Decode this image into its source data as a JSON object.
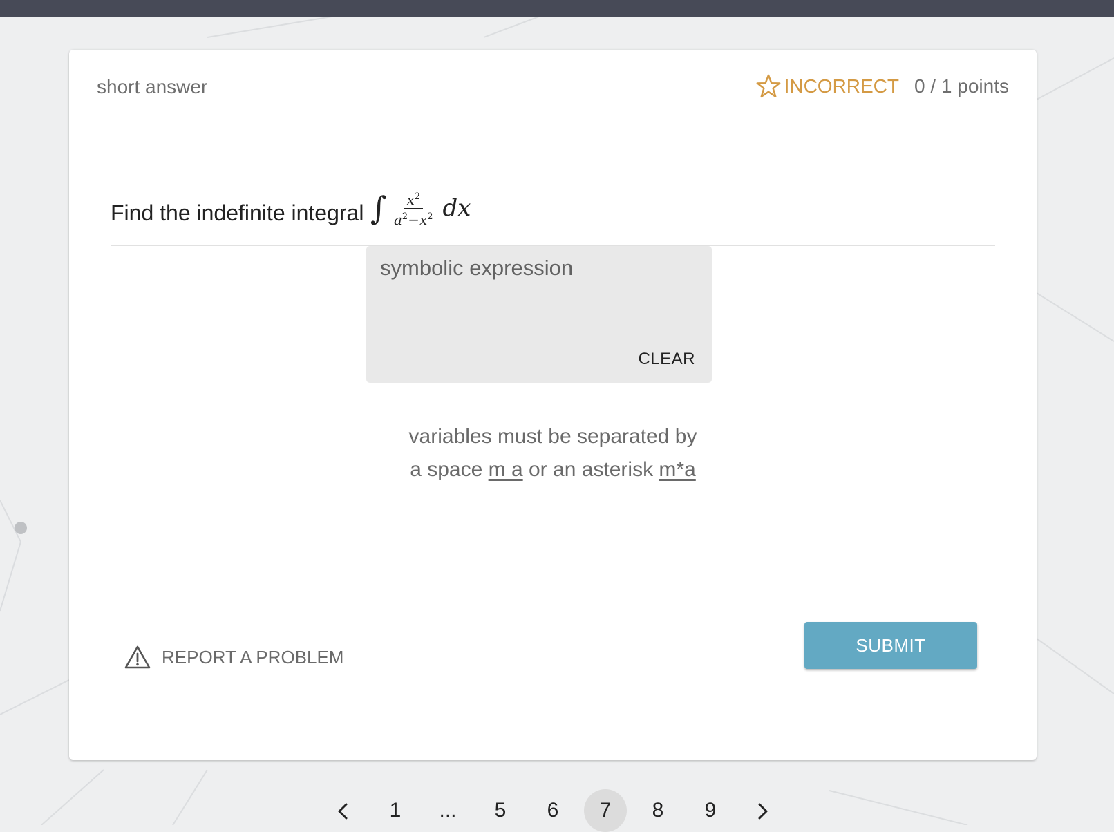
{
  "header": {
    "question_type": "short answer",
    "status_label": "INCORRECT",
    "points_label": "0 / 1 points",
    "status_icon": "star-outline-icon"
  },
  "question": {
    "prompt": "Find the indefinite integral",
    "math": {
      "integral_symbol": "∫",
      "numerator_var": "x",
      "numerator_exp": "2",
      "denominator_a": "a",
      "denominator_a_exp": "2",
      "denominator_op": "−",
      "denominator_x": "x",
      "denominator_x_exp": "2",
      "differential": "dx"
    }
  },
  "answer_input": {
    "placeholder": "symbolic expression",
    "clear_label": "CLEAR"
  },
  "hint": {
    "line1": "variables must be separated by",
    "line2_part1": "a space",
    "example1": "m a",
    "line2_part2": "or an asterisk",
    "example2": "m*a"
  },
  "actions": {
    "report_label": "REPORT A PROBLEM",
    "report_icon": "warning-triangle-icon",
    "submit_label": "SUBMIT"
  },
  "pagination": {
    "prev_icon": "chevron-left-icon",
    "next_icon": "chevron-right-icon",
    "pages": [
      "1",
      "...",
      "5",
      "6",
      "7",
      "8",
      "9"
    ],
    "current": "7"
  },
  "colors": {
    "top_bar": "#474a57",
    "status_accent": "#d49a44",
    "submit_button": "#63a9c3",
    "input_background": "#e9e9e9",
    "active_page": "#dcdcdc"
  }
}
